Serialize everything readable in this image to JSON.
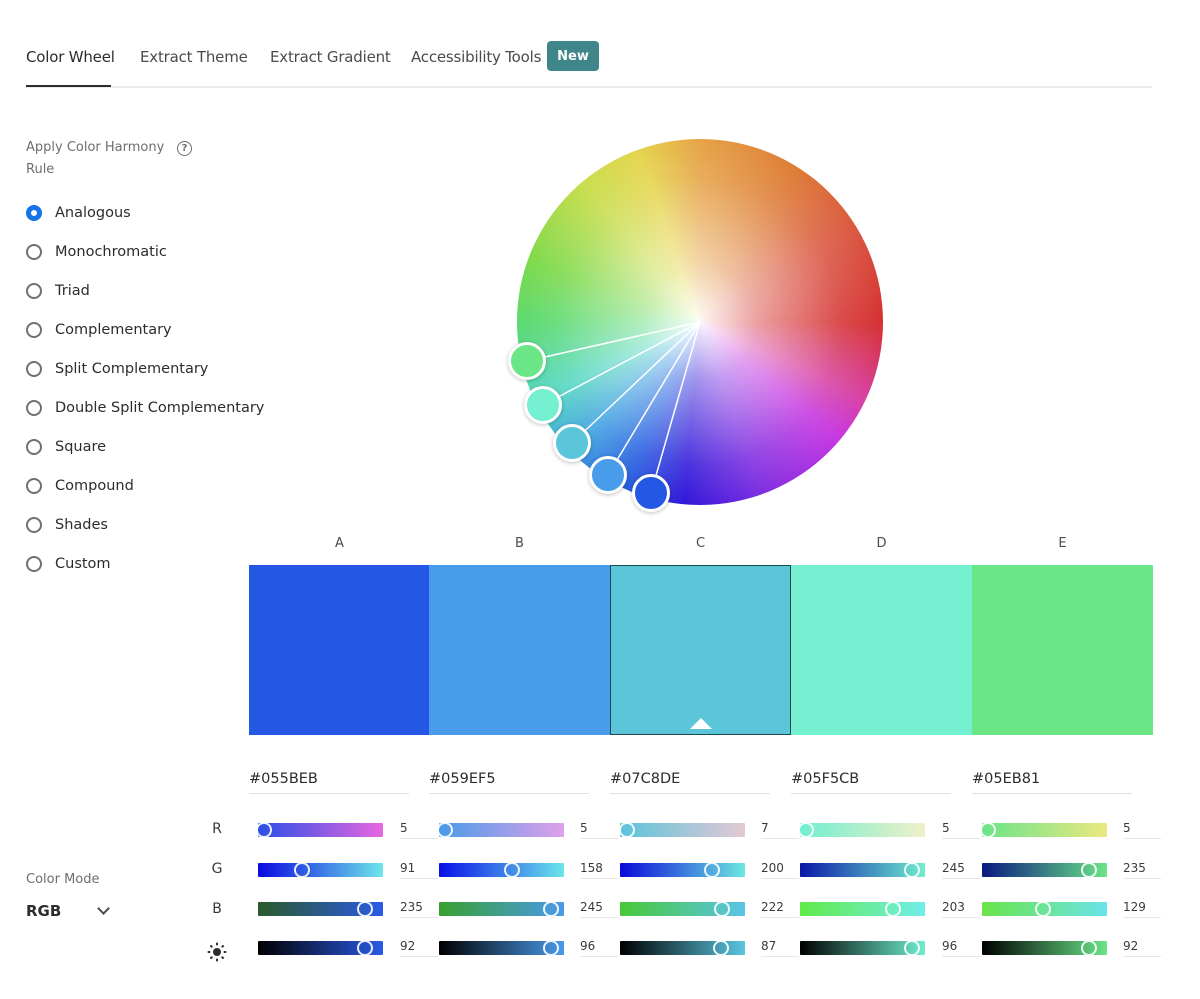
{
  "tabs": [
    {
      "label": "Color Wheel",
      "active": true
    },
    {
      "label": "Extract Theme",
      "active": false
    },
    {
      "label": "Extract Gradient",
      "active": false
    },
    {
      "label": "Accessibility Tools",
      "active": false
    }
  ],
  "new_badge": "New",
  "harmony": {
    "title": "Apply Color Harmony Rule",
    "help_icon": "question-circle-icon",
    "help_glyph": "?",
    "selected": "Analogous",
    "rules": [
      "Analogous",
      "Monochromatic",
      "Triad",
      "Complementary",
      "Split Complementary",
      "Double Split Complementary",
      "Square",
      "Compound",
      "Shades",
      "Custom"
    ]
  },
  "swatches": [
    {
      "label": "A",
      "hex": "#055BEB",
      "display": "#2457E3",
      "selected": false
    },
    {
      "label": "B",
      "hex": "#059EF5",
      "display": "#489CEA",
      "selected": false
    },
    {
      "label": "C",
      "hex": "#07C8DE",
      "display": "#5BC5DA",
      "selected": true
    },
    {
      "label": "D",
      "hex": "#05F5CB",
      "display": "#74EFD0",
      "selected": false
    },
    {
      "label": "E",
      "hex": "#05EB81",
      "display": "#6BE687",
      "selected": false
    }
  ],
  "channels": {
    "labels": [
      "R",
      "G",
      "B"
    ],
    "brightness_icon": "brightness-sun-icon"
  },
  "sliders": [
    {
      "R": 5,
      "G": 91,
      "B": 235,
      "brightness": 92
    },
    {
      "R": 5,
      "G": 158,
      "B": 245,
      "brightness": 96
    },
    {
      "R": 7,
      "G": 200,
      "B": 222,
      "brightness": 87
    },
    {
      "R": 5,
      "G": 245,
      "B": 203,
      "brightness": 96
    },
    {
      "R": 5,
      "G": 235,
      "B": 129,
      "brightness": 92
    }
  ],
  "slider_gradients": [
    {
      "R": [
        "#2a4fe6",
        "#e866e0"
      ],
      "G": [
        "#0a0ae0",
        "#6ee6ea"
      ],
      "B": [
        "#2a5a2a",
        "#2a5ae6"
      ],
      "brightness": [
        "#000000",
        "#2a5ae6"
      ]
    },
    {
      "R": [
        "#4a9ae8",
        "#e0a0ea"
      ],
      "G": [
        "#0a10e8",
        "#6ae6ea"
      ],
      "B": [
        "#38a030",
        "#4a9aea"
      ],
      "brightness": [
        "#000000",
        "#4a9aea"
      ]
    },
    {
      "R": [
        "#5ac4dc",
        "#e6c8d4"
      ],
      "G": [
        "#0a0ad8",
        "#6ce8e0"
      ],
      "B": [
        "#48c838",
        "#5ac4e6"
      ],
      "brightness": [
        "#000000",
        "#5ac6e0"
      ]
    },
    {
      "R": [
        "#70eed0",
        "#f0f0c8"
      ],
      "G": [
        "#0a18a8",
        "#70eed0"
      ],
      "B": [
        "#60ea48",
        "#70eeea"
      ],
      "brightness": [
        "#000000",
        "#70eed0"
      ]
    },
    {
      "R": [
        "#6ae488",
        "#ece880"
      ],
      "G": [
        "#0a1880",
        "#6ae488"
      ],
      "B": [
        "#6ae448",
        "#6ae4ea"
      ],
      "brightness": [
        "#000000",
        "#6ae488"
      ]
    }
  ],
  "color_mode": {
    "title": "Color Mode",
    "value": "RGB"
  },
  "colors": {
    "accent": "#1473E6",
    "badge": "#3F868A"
  }
}
